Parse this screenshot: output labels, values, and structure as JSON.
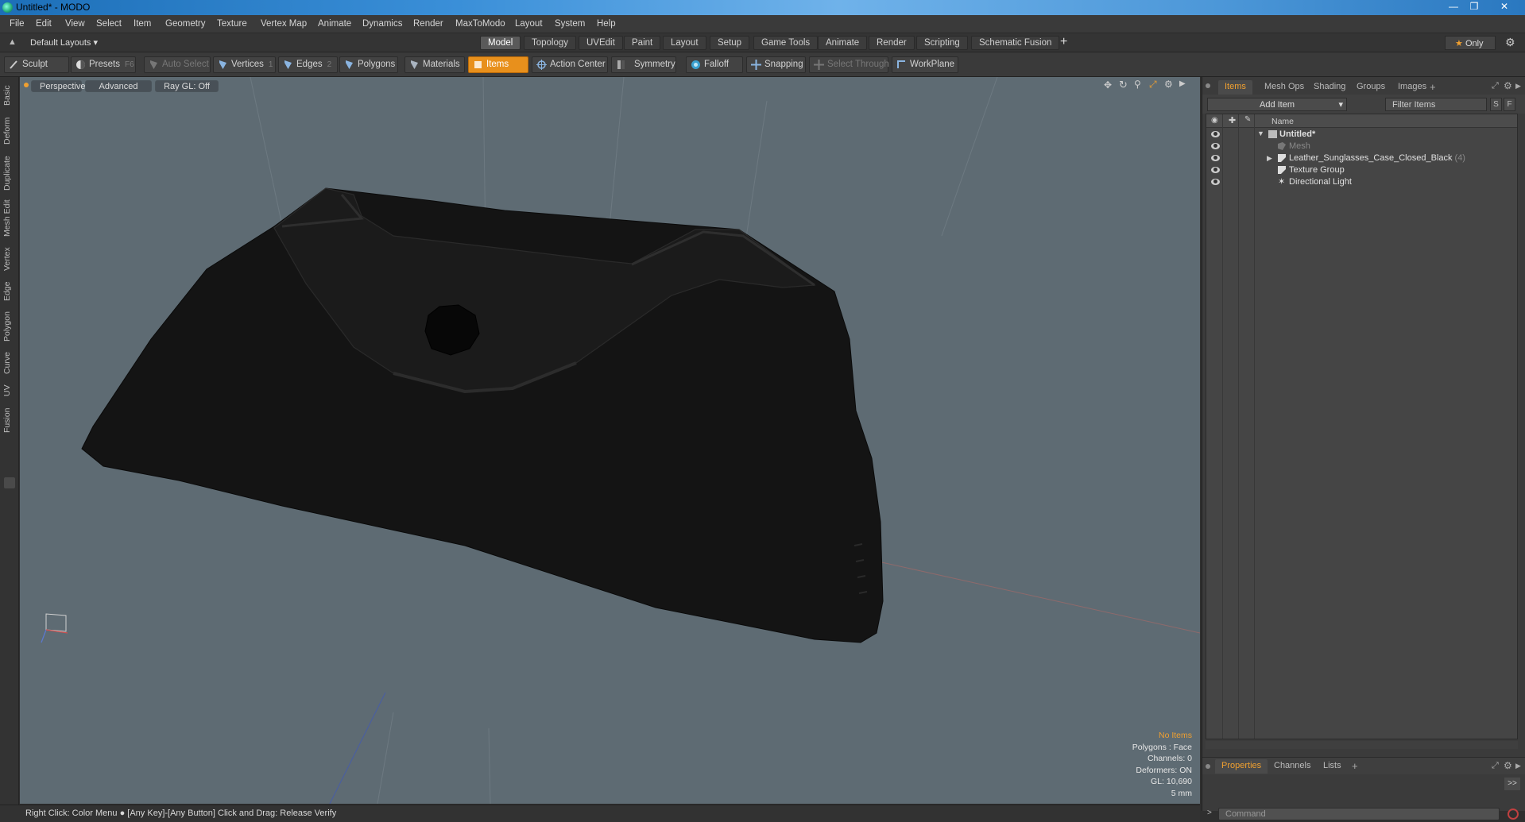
{
  "window": {
    "title": "Untitled* - MODO"
  },
  "menu": [
    "File",
    "Edit",
    "View",
    "Select",
    "Item",
    "Geometry",
    "Texture",
    "Vertex Map",
    "Animate",
    "Dynamics",
    "Render",
    "MaxToModo",
    "Layout",
    "System",
    "Help"
  ],
  "layout_selector": "Default Layouts",
  "layout_tabs": [
    "Model",
    "Topology",
    "UVEdit",
    "Paint",
    "Layout",
    "Setup",
    "Game Tools",
    "Animate",
    "Render",
    "Scripting",
    "Schematic Fusion"
  ],
  "active_layout_tab": "Model",
  "only_button": "Only",
  "tools": {
    "sculpt": "Sculpt",
    "presets": "Presets",
    "presets_key": "F6",
    "auto_select": "Auto Select",
    "vertices": "Vertices",
    "vertices_count": "1",
    "edges": "Edges",
    "edges_count": "2",
    "polygons": "Polygons",
    "materials": "Materials",
    "items": "Items",
    "action_center": "Action Center",
    "symmetry": "Symmetry",
    "falloff": "Falloff",
    "snapping": "Snapping",
    "select_through": "Select Through",
    "workplane": "WorkPlane"
  },
  "left_tabs": [
    "Basic",
    "Deform",
    "Duplicate",
    "Mesh Edit",
    "Vertex",
    "Edge",
    "Polygon",
    "Curve",
    "UV",
    "Fusion"
  ],
  "viewport": {
    "view": "Perspective",
    "shading": "Advanced",
    "raygl": "Ray GL: Off",
    "info": {
      "selection": "No Items",
      "polygons": "Polygons : Face",
      "channels": "Channels: 0",
      "deformers": "Deformers: ON",
      "gl": "GL: 10,690",
      "scale": "5 mm"
    }
  },
  "right_panel": {
    "tabs": [
      "Items",
      "Mesh Ops",
      "Shading",
      "Groups",
      "Images"
    ],
    "active_tab": "Items",
    "add_item": "Add Item",
    "filter": "Filter Items",
    "s_btn": "S",
    "f_btn": "F",
    "column_name": "Name",
    "tree": [
      {
        "label": "Untitled*",
        "count": ""
      },
      {
        "label": "Mesh",
        "count": ""
      },
      {
        "label": "Leather_Sunglasses_Case_Closed_Black",
        "count": "(4)"
      },
      {
        "label": "Texture Group",
        "count": ""
      },
      {
        "label": "Directional Light",
        "count": ""
      }
    ],
    "bottom_tabs": [
      "Properties",
      "Channels",
      "Lists"
    ],
    "active_bottom_tab": "Properties",
    "command_placeholder": "Command"
  },
  "status": "Right Click: Color Menu ● [Any Key]-[Any Button] Click and Drag: Release Verify",
  "colors": {
    "accent": "#e8901c",
    "viewport_bg": "#5e6b73",
    "panel_bg": "#3b3b3b"
  }
}
